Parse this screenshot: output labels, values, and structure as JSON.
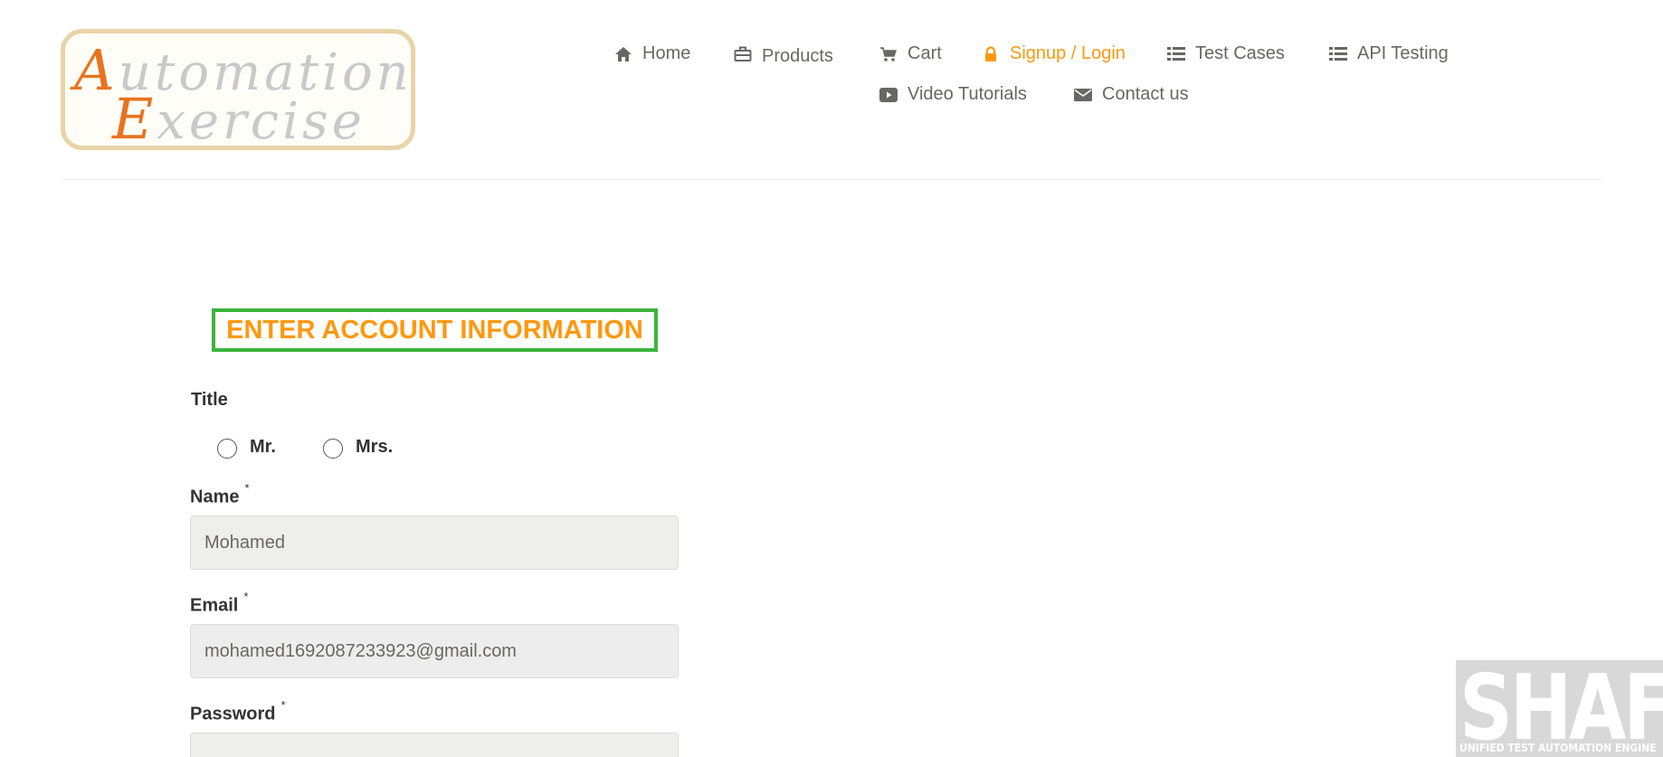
{
  "logo": {
    "line1_cap": "A",
    "line1_rest": "utomation",
    "line2_cap": "E",
    "line2_rest": "xercise"
  },
  "nav": {
    "items": [
      {
        "label": "Home",
        "icon": "home-icon"
      },
      {
        "label": "Products",
        "icon": "briefcase-icon"
      },
      {
        "label": "Cart",
        "icon": "cart-icon"
      },
      {
        "label": "Signup / Login",
        "icon": "lock-icon",
        "active": true
      },
      {
        "label": "Test Cases",
        "icon": "list-icon"
      },
      {
        "label": "API Testing",
        "icon": "list-icon"
      },
      {
        "label": "Video Tutorials",
        "icon": "video-icon"
      },
      {
        "label": "Contact us",
        "icon": "envelope-icon"
      }
    ],
    "active_color": "#fe980f"
  },
  "form": {
    "heading": "ENTER ACCOUNT INFORMATION",
    "title_label": "Title",
    "title_options": [
      "Mr.",
      "Mrs."
    ],
    "name_label": "Name",
    "name_value": "Mohamed",
    "email_label": "Email",
    "email_value": "mohamed1692087233923@gmail.com",
    "password_label": "Password",
    "password_value": "",
    "required_mark": "*"
  },
  "watermark": {
    "title": "SHAFT",
    "subtitle": "UNIFIED TEST AUTOMATION ENGINE"
  }
}
